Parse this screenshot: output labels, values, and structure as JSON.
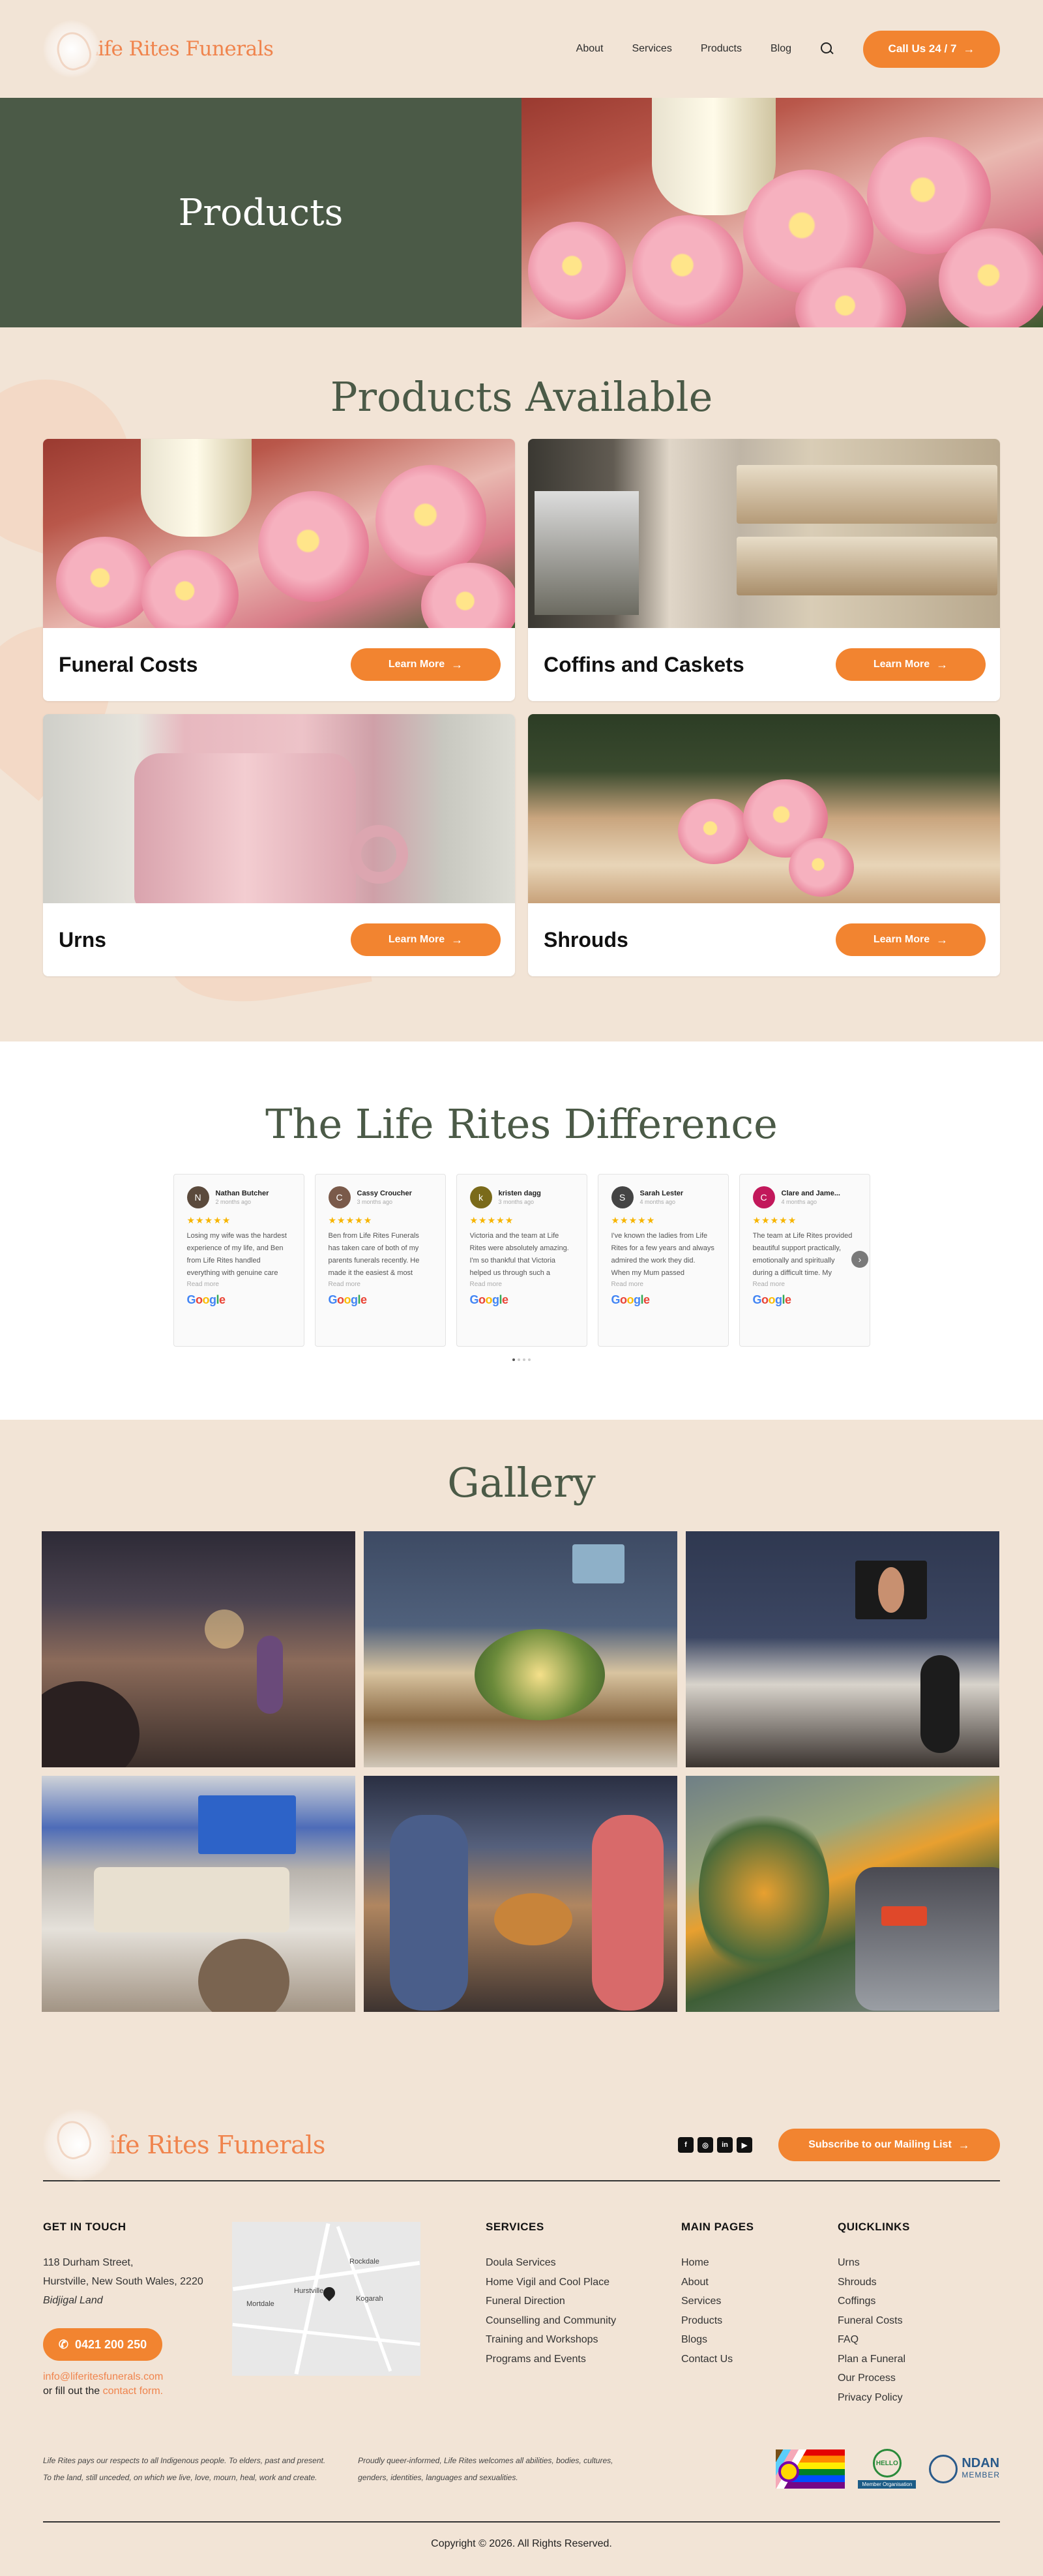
{
  "header": {
    "logo": "Life Rites Funerals",
    "nav": [
      "About",
      "Services",
      "Products",
      "Blog"
    ],
    "call_label": "Call Us 24 / 7"
  },
  "hero": {
    "title": "Products"
  },
  "products": {
    "title": "Products Available",
    "items": [
      {
        "title": "Funeral Costs",
        "button": "Learn More"
      },
      {
        "title": "Coffins and Caskets",
        "button": "Learn More"
      },
      {
        "title": "Urns",
        "button": "Learn More"
      },
      {
        "title": "Shrouds",
        "button": "Learn More"
      }
    ]
  },
  "difference": {
    "title": "The Life Rites Difference",
    "reviews": [
      {
        "name": "Nathan Butcher",
        "initial": "N",
        "avatar_color": "#5b4a3c",
        "date": "2 months ago",
        "stars": "★★★★★",
        "text": "Losing my wife was the hardest experience of my life, and Ben from Life Rites handled everything with genuine care and...",
        "read_more": "Read more"
      },
      {
        "name": "Cassy Croucher",
        "initial": "C",
        "avatar_color": "#7a5a4a",
        "date": "3 months ago",
        "stars": "★★★★★",
        "text": "Ben from Life Rites Funerals has taken care of both of my parents funerals recently. He made it the easiest & most beautiful experience & with...",
        "read_more": "Read more"
      },
      {
        "name": "kristen dagg",
        "initial": "k",
        "avatar_color": "#7a6a1a",
        "date": "3 months ago",
        "stars": "★★★★★",
        "text": "Victoria and the team at Life Rites were absolutely amazing. I'm so thankful that Victoria helped us through such a difficult time. She w...",
        "read_more": "Read more"
      },
      {
        "name": "Sarah Lester",
        "initial": "S",
        "avatar_color": "#444444",
        "date": "4 months ago",
        "stars": "★★★★★",
        "text": "I've known the ladies from Life Rites for a few years and always admired the work they did. When my Mum passed suddenly I called...",
        "read_more": "Read more"
      },
      {
        "name": "Clare and Jame...",
        "initial": "C",
        "avatar_color": "#c2185b",
        "date": "4 months ago",
        "stars": "★★★★★",
        "text": "The team at Life Rites provided beautiful support practically, emotionally and spiritually during a difficult time. My mother-in-law die...",
        "read_more": "Read more"
      }
    ],
    "google_label": [
      "G",
      "o",
      "o",
      "g",
      "l",
      "e"
    ]
  },
  "gallery": {
    "title": "Gallery"
  },
  "footer": {
    "logo": "Life Rites Funerals",
    "socials": [
      "f",
      "◎",
      "in",
      "▶"
    ],
    "subscribe_label": "Subscribe to our Mailing List",
    "get_in_touch": {
      "heading": "GET IN TOUCH",
      "address_line1": "118 Durham Street,",
      "address_line2": "Hurstville, New South Wales, 2220",
      "address_line3": "Bidjigal Land",
      "phone": "0421 200 250",
      "email": "info@liferitesfunerals.com",
      "fill_prefix": "or fill out the",
      "fill_link": "contact form."
    },
    "map_labels": [
      "Rockdale",
      "Kogarah",
      "Hurstville",
      "Mortdale"
    ],
    "services": {
      "heading": "SERVICES",
      "items": [
        "Doula Services",
        "Home Vigil and Cool Place",
        "Funeral Direction",
        "Counselling and Community",
        "Training and Workshops",
        "Programs and Events"
      ]
    },
    "main_pages": {
      "heading": "MAIN PAGES",
      "items": [
        "Home",
        "About",
        "Services",
        "Products",
        "Blogs",
        "Contact Us"
      ]
    },
    "quicklinks": {
      "heading": "QUICKLINKS",
      "items": [
        "Urns",
        "Shrouds",
        "Coffings",
        "Funeral Costs",
        "FAQ",
        "Plan a Funeral",
        "Our Process",
        "Privacy Policy"
      ]
    },
    "acknowledgement_1": "Life Rites pays our respects to all Indigenous people. To elders, past and present.",
    "acknowledgement_2": "To the land, still unceded, on which we live, love, mourn, heal, work and create.",
    "inclusion_1": "Proudly queer-informed, Life Rites welcomes all abilities, bodies, cultures,",
    "inclusion_2": "genders, identities, languages and sexualities.",
    "hello_badge": "HELLO",
    "hello_tag": "Member Organisation",
    "ndan_name": "NDAN",
    "ndan_sub": "MEMBER",
    "copyright": "Copyright © 2026. All Rights Reserved."
  }
}
